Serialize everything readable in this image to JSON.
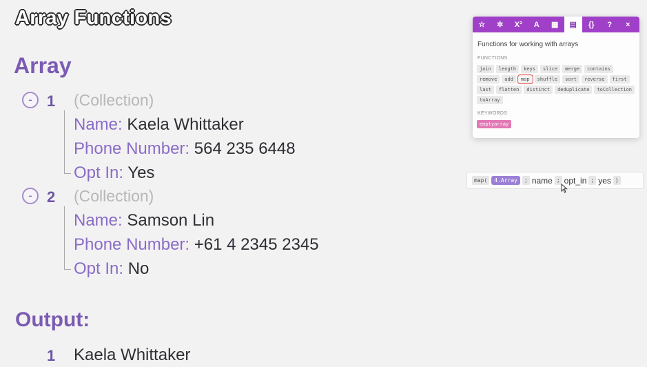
{
  "page": {
    "title": "Array Functions"
  },
  "array_section": {
    "heading": "Array",
    "items": [
      {
        "collapse": "-",
        "index": "1",
        "type": "(Collection)",
        "fields": [
          {
            "key": "Name:",
            "value": "Kaela Whittaker"
          },
          {
            "key": "Phone Number:",
            "value": "564 235 6448"
          },
          {
            "key": "Opt In:",
            "value": "Yes"
          }
        ]
      },
      {
        "collapse": "-",
        "index": "2",
        "type": "(Collection)",
        "fields": [
          {
            "key": "Name:",
            "value": "Samson Lin"
          },
          {
            "key": "Phone Number:",
            "value": "+61 4 2345 2345"
          },
          {
            "key": "Opt In:",
            "value": "No"
          }
        ]
      }
    ]
  },
  "output_section": {
    "heading": "Output:",
    "rows": [
      {
        "index": "1",
        "value": "Kaela Whittaker"
      }
    ]
  },
  "function_panel": {
    "tabs": [
      {
        "icon": "star-icon",
        "glyph": "☆"
      },
      {
        "icon": "gear-icon",
        "glyph": "✲"
      },
      {
        "icon": "superscript-icon",
        "glyph": "X²"
      },
      {
        "icon": "text-icon",
        "glyph": "A"
      },
      {
        "icon": "calendar-icon",
        "glyph": "▦"
      },
      {
        "icon": "array-table-icon",
        "glyph": "▤"
      },
      {
        "icon": "braces-icon",
        "glyph": "{}"
      },
      {
        "icon": "help-icon",
        "glyph": "?"
      },
      {
        "icon": "close-icon",
        "glyph": "×"
      }
    ],
    "description": "Functions for working with arrays",
    "functions_label": "FUNCTIONS",
    "functions": [
      "join",
      "length",
      "keys",
      "slice",
      "merge",
      "contains",
      "remove",
      "add",
      "map",
      "shuffle",
      "sort",
      "reverse",
      "first",
      "last",
      "flatten",
      "distinct",
      "deduplicate",
      "toCollection",
      "toArray"
    ],
    "highlighted_function": "map",
    "keywords_label": "KEYWORDS",
    "keywords": [
      "emptyarray"
    ],
    "accent_color": "#a040c8",
    "highlight_color": "#e0403c"
  },
  "formula_bar": {
    "open": "map(",
    "array_pill": "4.Array",
    "sep": ";",
    "arg1": "name",
    "arg2": "opt_in",
    "arg3": "yes",
    "close": ")"
  },
  "colors": {
    "purple": "#7b5bb2",
    "key_purple": "#8a6cc6"
  }
}
